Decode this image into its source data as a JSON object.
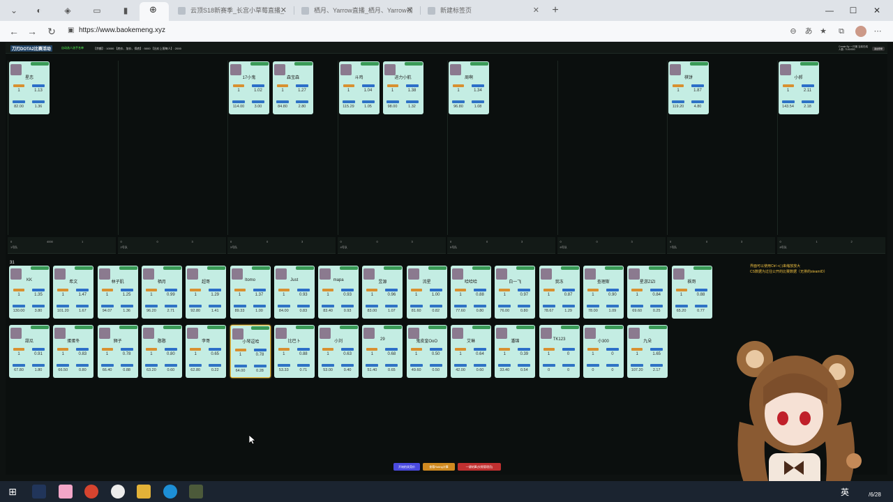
{
  "browser": {
    "tabs": [
      {
        "label": "云顶S18新赛季_长宫小草莓直播_",
        "active": false
      },
      {
        "label": "栖月、Yarrow直播_栖月、Yarrow视",
        "active": false
      },
      {
        "label": "新建标签页",
        "active": false
      }
    ],
    "url": "https://www.baokemeng.xyz",
    "new_tab": "+"
  },
  "app": {
    "title": "刀刃DOTA2比赛活动",
    "subtitle": "自动选人选手名单",
    "stats": "【余额】: 10000   【底价、加价、保底】: 5000   【出价上限每人】: 2000",
    "credit": "Create By 一只猪  当前在线人数: 7100/000",
    "top_button": "退出登录",
    "pool_count": "31",
    "note1": "界面可以使用Ctrl +(-)来缩放放大",
    "note2": "CS数据为过往公开的比赛数据（无排的steamID）",
    "bottom_buttons": [
      {
        "label": "开始拍卖竞价",
        "color": "#4a4adf"
      },
      {
        "label": "查看Rating计算",
        "color": "#d08a20"
      },
      {
        "label": "一键结算(仅限管理员)",
        "color": "#c03030"
      }
    ]
  },
  "teams": [
    {
      "members": [
        {
          "name": "星恋",
          "gold": "1",
          "rating": "1.13",
          "val": "82.00",
          "avg": "1.36"
        }
      ],
      "footer": {
        "label": "1号队",
        "c1": "0",
        "c2": "4000",
        "c3": "1"
      }
    },
    {
      "members": [],
      "footer": {
        "label": "2号队",
        "c1": "0",
        "c2": "0",
        "c3": "3"
      }
    },
    {
      "members": [
        {
          "name": "17小鬼",
          "gold": "1",
          "rating": "1.02",
          "val": "114.00",
          "avg": "3.00"
        },
        {
          "name": "森宝森",
          "gold": "1",
          "rating": "1.27",
          "val": "84.80",
          "avg": "2.80"
        }
      ],
      "footer": {
        "label": "3号队",
        "c1": "0",
        "c2": "0",
        "c3": "3"
      }
    },
    {
      "members": [
        {
          "name": "斗鸡",
          "gold": "1",
          "rating": "1.04",
          "val": "115.29",
          "avg": "1.05"
        },
        {
          "name": "进力小航",
          "gold": "1",
          "rating": "1.38",
          "val": "98.00",
          "avg": "1.32"
        }
      ],
      "footer": {
        "label": "4号队",
        "c1": "0",
        "c2": "0",
        "c3": "3"
      }
    },
    {
      "members": [
        {
          "name": "周啊",
          "gold": "1",
          "rating": "1.34",
          "val": "96.80",
          "avg": "1.08"
        }
      ],
      "footer": {
        "label": "5号队",
        "c1": "0",
        "c2": "0",
        "c3": "3"
      }
    },
    {
      "members": [],
      "footer": {
        "label": "6号队",
        "c1": "0",
        "c2": "0",
        "c3": "3"
      }
    },
    {
      "members": [
        {
          "name": "棋饼",
          "gold": "1",
          "rating": "1.87",
          "val": "119.20",
          "avg": "4.80"
        }
      ],
      "footer": {
        "label": "7号队",
        "c1": "0",
        "c2": "0",
        "c3": "3"
      }
    },
    {
      "members": [
        {
          "name": "小郝",
          "gold": "1",
          "rating": "2.11",
          "val": "143.54",
          "avg": "2.18"
        }
      ],
      "footer": {
        "label": "8号队",
        "c1": "0",
        "c2": "1",
        "c3": "2"
      }
    }
  ],
  "pool_row1": [
    {
      "name": "KK",
      "gold": "1",
      "rating": "1.35",
      "val": "130.00",
      "avg": "3.80"
    },
    {
      "name": "希文",
      "gold": "1",
      "rating": "1.47",
      "val": "101.20",
      "avg": "1.67"
    },
    {
      "name": "林子肌",
      "gold": "1",
      "rating": "1.25",
      "val": "94.07",
      "avg": "1.36"
    },
    {
      "name": "栖月",
      "gold": "1",
      "rating": "0.99",
      "val": "96.20",
      "avg": "2.71"
    },
    {
      "name": "超哥",
      "gold": "1",
      "rating": "1.29",
      "val": "92.80",
      "avg": "1.41"
    },
    {
      "name": "Itomo",
      "gold": "1",
      "rating": "1.37",
      "val": "89.33",
      "avg": "1.00"
    },
    {
      "name": "Just",
      "gold": "1",
      "rating": "0.93",
      "val": "84.00",
      "avg": "0.83"
    },
    {
      "name": "mapa",
      "gold": "1",
      "rating": "0.93",
      "val": "83.40",
      "avg": "0.93"
    },
    {
      "name": "昱源",
      "gold": "1",
      "rating": "0.96",
      "val": "83.00",
      "avg": "1.07"
    },
    {
      "name": "流星",
      "gold": "1",
      "rating": "1.00",
      "val": "81.60",
      "avg": "0.82"
    },
    {
      "name": "哈哈哈",
      "gold": "1",
      "rating": "0.88",
      "val": "77.60",
      "avg": "0.80"
    },
    {
      "name": "白一飞",
      "gold": "1",
      "rating": "0.97",
      "val": "76.00",
      "avg": "0.80"
    },
    {
      "name": "我冻",
      "gold": "1",
      "rating": "0.87",
      "val": "78.67",
      "avg": "1.29"
    },
    {
      "name": "查理斯",
      "gold": "1",
      "rating": "0.90",
      "val": "78.00",
      "avg": "1.09"
    },
    {
      "name": "星游ZIZI",
      "gold": "1",
      "rating": "0.84",
      "val": "69.60",
      "avg": "0.25"
    },
    {
      "name": "枫哥",
      "gold": "1",
      "rating": "0.88",
      "val": "65.20",
      "avg": "0.77"
    }
  ],
  "pool_row2": [
    {
      "name": "甜瓜",
      "gold": "1",
      "rating": "0.91",
      "val": "67.80",
      "avg": "1.80"
    },
    {
      "name": "蛋蛋冬",
      "gold": "1",
      "rating": "0.83",
      "val": "66.50",
      "avg": "0.80"
    },
    {
      "name": "狮子",
      "gold": "1",
      "rating": "0.78",
      "val": "66.40",
      "avg": "0.88"
    },
    {
      "name": "憨憨",
      "gold": "1",
      "rating": "0.80",
      "val": "63.20",
      "avg": "0.60"
    },
    {
      "name": "李哥",
      "gold": "1",
      "rating": "0.65",
      "val": "62.80",
      "avg": "0.22"
    },
    {
      "name": "小琴逗哈",
      "gold": "1",
      "rating": "0.78",
      "val": "64.00",
      "avg": "0.28"
    },
    {
      "name": "比巴卜",
      "gold": "1",
      "rating": "0.88",
      "val": "53.33",
      "avg": "0.71"
    },
    {
      "name": "小刘",
      "gold": "1",
      "rating": "0.63",
      "val": "53.00",
      "avg": "0.40"
    },
    {
      "name": "29",
      "gold": "1",
      "rating": "0.68",
      "val": "51.40",
      "avg": "0.65"
    },
    {
      "name": "鬼皮皇OoO",
      "gold": "1",
      "rating": "0.50",
      "val": "49.60",
      "avg": "0.50"
    },
    {
      "name": "艾琳",
      "gold": "1",
      "rating": "0.64",
      "val": "42.00",
      "avg": "0.60"
    },
    {
      "name": "潘锦",
      "gold": "1",
      "rating": "0.39",
      "val": "33.40",
      "avg": "0.54"
    },
    {
      "name": "TK123",
      "gold": "1",
      "rating": "0",
      "val": "0",
      "avg": "0"
    },
    {
      "name": "小300",
      "gold": "1",
      "rating": "0",
      "val": "0",
      "avg": "0"
    },
    {
      "name": "九朵",
      "gold": "1",
      "rating": "1.65",
      "val": "107.20",
      "avg": "2.17"
    }
  ],
  "taskbar": {
    "lang": "英",
    "date": "/6/28"
  }
}
